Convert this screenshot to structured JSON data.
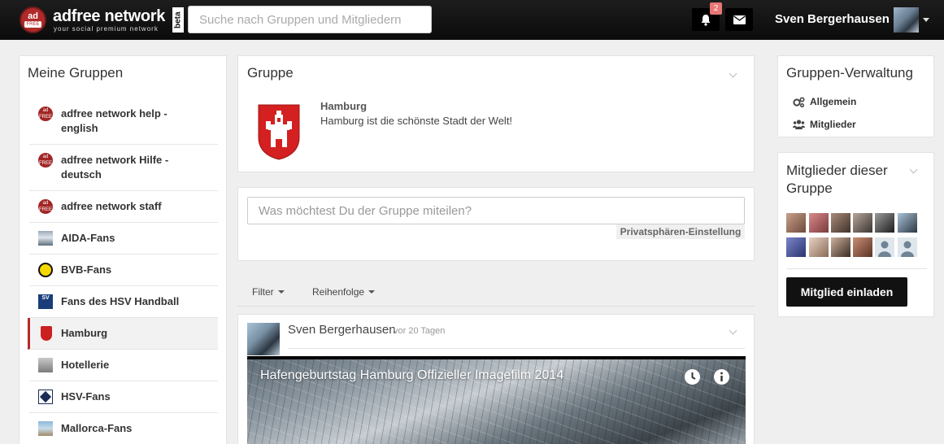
{
  "header": {
    "logo_top": "ad",
    "logo_bottom": "FREE",
    "brand": "adfree network",
    "tagline": "your social premium network",
    "beta": "beta",
    "search_placeholder": "Suche nach Gruppen und Mitgliedern",
    "notification_count": "2",
    "user_name": "Sven Bergerhausen"
  },
  "left": {
    "title": "Meine Gruppen",
    "groups": [
      {
        "label_line1": "adfree network help -",
        "label_line2": "english"
      },
      {
        "label_line1": "adfree network Hilfe -",
        "label_line2": "deutsch"
      },
      {
        "label_line1": "adfree network staff"
      },
      {
        "label_line1": "AIDA-Fans"
      },
      {
        "label_line1": "BVB-Fans"
      },
      {
        "label_line1": "Fans des HSV Handball"
      },
      {
        "label_line1": "Hamburg"
      },
      {
        "label_line1": "Hotellerie"
      },
      {
        "label_line1": "HSV-Fans"
      },
      {
        "label_line1": "Mallorca-Fans"
      }
    ],
    "icon_text": {
      "ad": "ad",
      "free": "FREE",
      "sv": "SV"
    }
  },
  "center": {
    "group_card_title": "Gruppe",
    "group_name": "Hamburg",
    "group_description": "Hamburg ist die schönste Stadt der Welt!",
    "post_placeholder": "Was möchtest Du der Gruppe miteilen?",
    "privacy_label": "Privatsphären-Einstellung",
    "filter_label": "Filter",
    "order_label": "Reihenfolge",
    "post": {
      "author": "Sven Bergerhausen",
      "time": "vor 20 Tagen",
      "video_title": "Hafengeburtstag Hamburg Offizieller Imagefilm 2014"
    }
  },
  "right": {
    "admin_title": "Gruppen-Verwaltung",
    "admin_links": [
      "Allgemein",
      "Mitglieder"
    ],
    "members_title_line1": "Mitglieder dieser",
    "members_title_line2": "Gruppe",
    "invite_label": "Mitglied einladen"
  },
  "colors": {
    "brand_red": "#b02a2a",
    "topbar": "#111111",
    "active_marker": "#b32b2b",
    "badge": "#e97676"
  }
}
